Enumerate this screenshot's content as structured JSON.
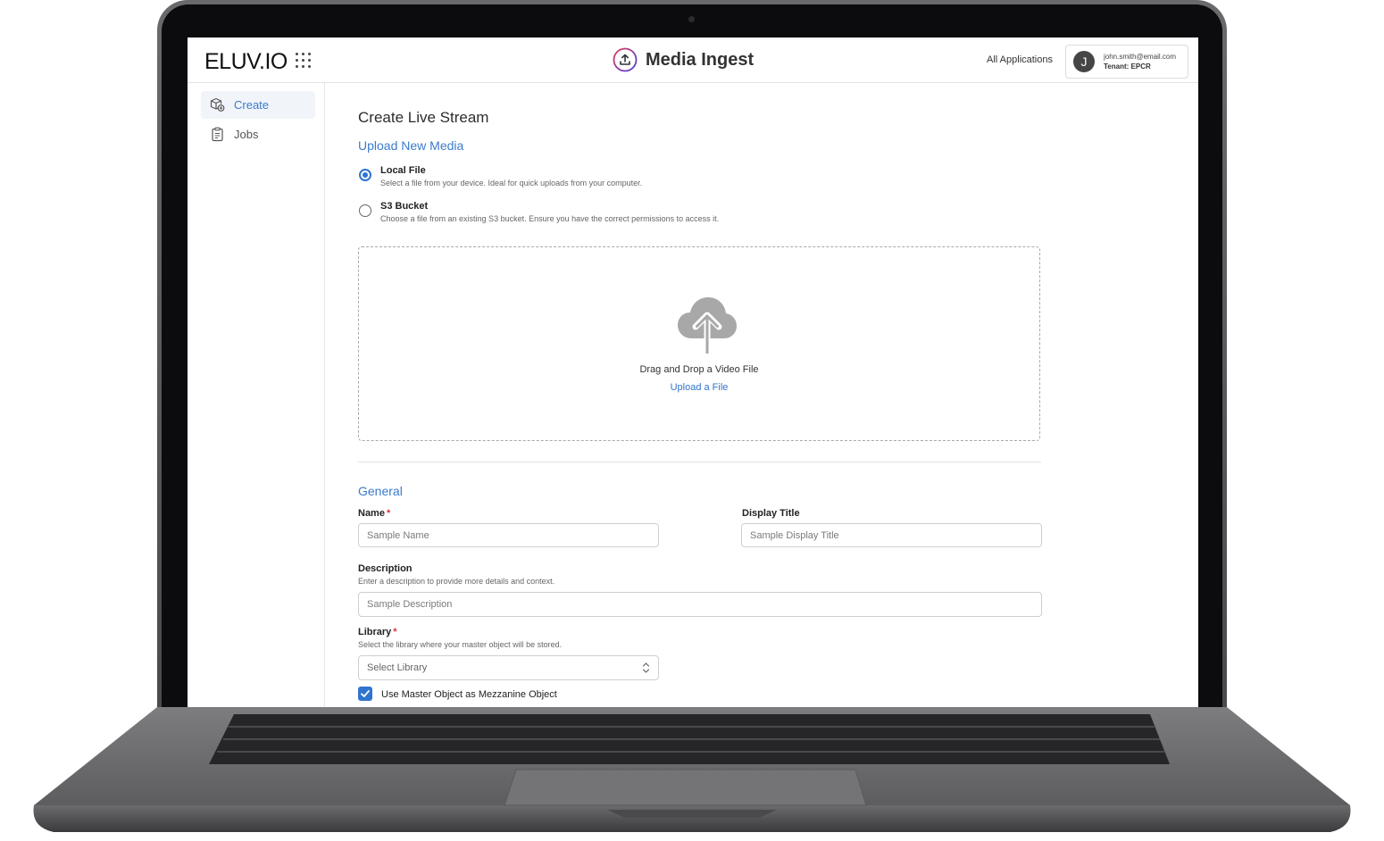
{
  "header": {
    "logo_text": "ELUV.IO",
    "app_title": "Media Ingest",
    "all_applications": "All Applications",
    "user": {
      "avatar_initial": "J",
      "email": "john.smith@email.com",
      "tenant": "Tenant: EPCR"
    }
  },
  "sidebar": {
    "items": [
      {
        "label": "Create",
        "icon": "create-package-icon",
        "active": true
      },
      {
        "label": "Jobs",
        "icon": "clipboard-icon",
        "active": false
      }
    ]
  },
  "main": {
    "page_title": "Create Live Stream",
    "upload_section_title": "Upload New Media",
    "sources": [
      {
        "label": "Local File",
        "description": "Select a file from your device. Ideal for quick uploads from your computer.",
        "selected": true
      },
      {
        "label": "S3 Bucket",
        "description": "Choose a file from an existing S3 bucket. Ensure you have the correct permissions to access it.",
        "selected": false
      }
    ],
    "dropzone": {
      "icon": "cloud-upload-icon",
      "text": "Drag and Drop a Video File",
      "link": "Upload a File"
    },
    "general_section_title": "General",
    "fields": {
      "name": {
        "label": "Name",
        "required_mark": "*",
        "placeholder": "Sample Name",
        "value": ""
      },
      "display_title": {
        "label": "Display Title",
        "placeholder": "Sample Display Title",
        "value": ""
      },
      "description": {
        "label": "Description",
        "help": "Enter a description to provide more details and context.",
        "placeholder": "Sample Description",
        "value": ""
      },
      "library": {
        "label": "Library",
        "required_mark": "*",
        "help": "Select the library where your master object will be stored.",
        "placeholder": "Select Library"
      }
    },
    "mezzanine_checkbox": {
      "label": "Use Master Object as Mezzanine Object",
      "checked": true
    }
  },
  "colors": {
    "accent": "#2f74d0",
    "section_title": "#3a7bcc",
    "required": "#d33333"
  }
}
